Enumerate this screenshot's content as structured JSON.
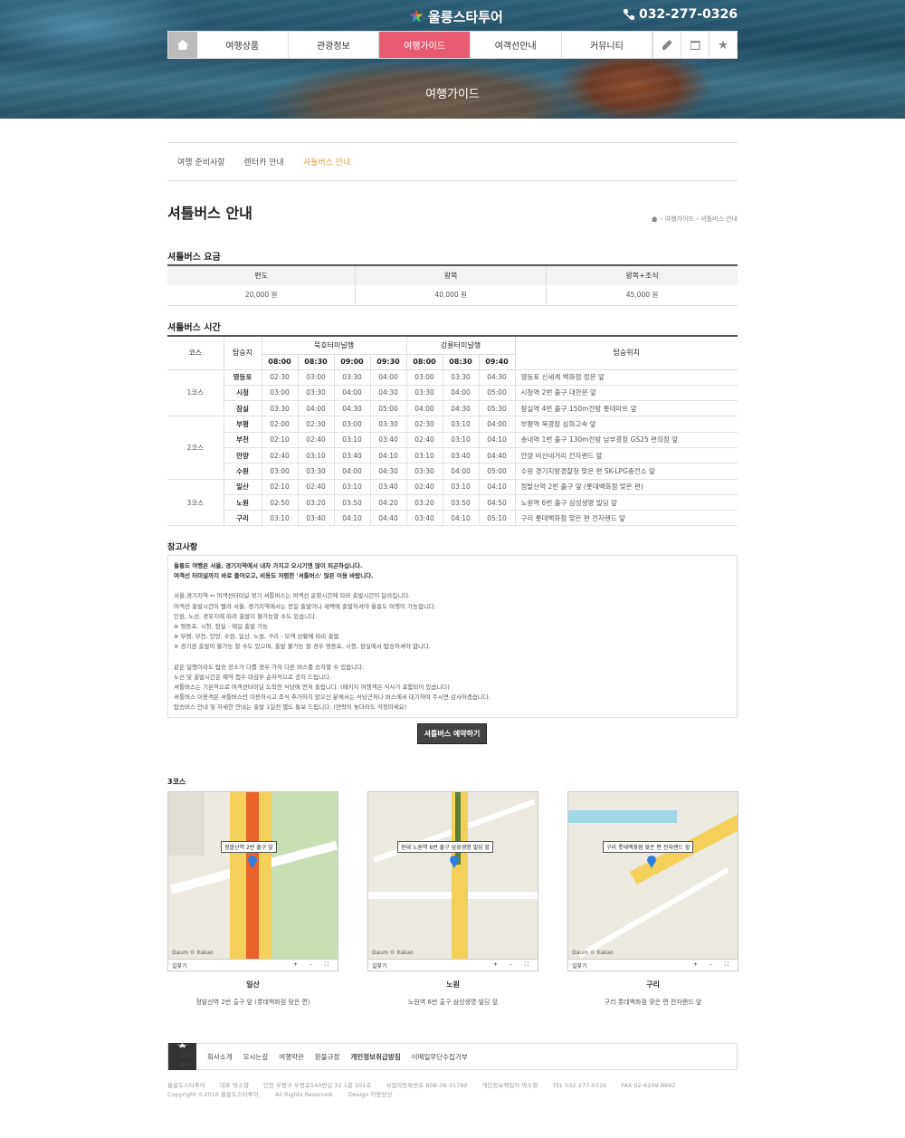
{
  "header": {
    "logo_text": "울릉스타투어",
    "phone": "032-277-0326",
    "nav": [
      "여행상품",
      "관광정보",
      "여행가이드",
      "여객선안내",
      "커뮤니티"
    ],
    "active_nav": "여행가이드",
    "hero_title": "여행가이드"
  },
  "subnav": [
    "여행 준비사항",
    "렌터카 안내",
    "셔틀버스 안내"
  ],
  "page_title": "셔틀버스 안내",
  "breadcrumb": "› 여행가이드 › 셔틀버스 안내",
  "fare": {
    "title": "셔틀버스 요금",
    "headers": [
      "편도",
      "왕복",
      "왕복+조식"
    ],
    "values": [
      "20,000 원",
      "40,000 원",
      "45,000 원"
    ]
  },
  "schedule": {
    "title": "셔틀버스 시간",
    "h_course": "코스",
    "h_stop": "탑승지",
    "h_mukho": "묵호터미널행",
    "h_gangneung": "강릉터미널행",
    "h_loc": "탑승위치",
    "times": [
      "08:00",
      "08:30",
      "09:00",
      "09:30",
      "08:00",
      "08:30",
      "09:40"
    ],
    "courses": [
      {
        "name": "1코스",
        "rows": [
          {
            "stop": "영등포",
            "t": [
              "02:30",
              "03:00",
              "03:30",
              "04:00",
              "03:00",
              "03:30",
              "04:30"
            ],
            "loc": "영등포 신세계 백화점 정문 앞"
          },
          {
            "stop": "시청",
            "t": [
              "03:00",
              "03:30",
              "04:00",
              "04:30",
              "03:30",
              "04:00",
              "05:00"
            ],
            "loc": "시청역 2번 출구 대한문 앞"
          },
          {
            "stop": "잠실",
            "t": [
              "03:30",
              "04:00",
              "04:30",
              "05:00",
              "04:00",
              "04:30",
              "05:30"
            ],
            "loc": "잠실역 4번 출구 150m전방 롯데마트 앞"
          }
        ]
      },
      {
        "name": "2코스",
        "rows": [
          {
            "stop": "부평",
            "t": [
              "02:00",
              "02:30",
              "03:00",
              "03:30",
              "02:30",
              "03:10",
              "04:00"
            ],
            "loc": "부평역 북광장 삼화고속 앞"
          },
          {
            "stop": "부천",
            "t": [
              "02:10",
              "02:40",
              "03:10",
              "03:40",
              "02:40",
              "03:10",
              "04:10"
            ],
            "loc": "송내역 1번 출구 130m전방 남부광장 GS25 편의점 앞"
          },
          {
            "stop": "안양",
            "t": [
              "02:40",
              "03:10",
              "03:40",
              "04:10",
              "03:10",
              "03:40",
              "04:40"
            ],
            "loc": "안양 비산네거리 전자랜드 앞"
          },
          {
            "stop": "수원",
            "t": [
              "03:00",
              "03:30",
              "04:00",
              "04:30",
              "03:30",
              "04:00",
              "05:00"
            ],
            "loc": "수원 경기지방경찰청 맞은 편 SK-LPG충전소 앞"
          }
        ]
      },
      {
        "name": "3코스",
        "rows": [
          {
            "stop": "일산",
            "t": [
              "02:10",
              "02:40",
              "03:10",
              "03:40",
              "02:40",
              "03:10",
              "04:10"
            ],
            "loc": "정발산역 2번 출구 앞 (롯데백화점 맞은 편)"
          },
          {
            "stop": "노원",
            "t": [
              "02:50",
              "03:20",
              "03:50",
              "04:20",
              "03:20",
              "03:50",
              "04:50"
            ],
            "loc": "노원역 6번 출구 삼성생명 빌딩 앞"
          },
          {
            "stop": "구리",
            "t": [
              "03:10",
              "03:40",
              "04:10",
              "04:40",
              "03:40",
              "04:10",
              "05:10"
            ],
            "loc": "구리 롯데백화점 맞은 편 전자랜드 앞"
          }
        ]
      }
    ]
  },
  "notes": {
    "title": "참고사항",
    "intro": [
      "울릉도 여행은 서울, 경기지역에서 내차 가지고 오시기엔 많이 피곤하십니다.",
      "여객선 터미널까지 바로 들어오고, 비용도 저렴한 '셔틀버스' 많은 이용 바랍니다."
    ],
    "block1": [
      "서울,경기지역 ↔ 여객선터미널 정기 셔틀버스는 여객선 운항시간에 따라 출발시간이 달라집니다.",
      "여객선 출발시간이 빨라 서울, 경기지역에서는 전일 출발이나 새벽에 출발하셔야 울릉도 여행이 가능합니다.",
      "인원, 노선, 경유지에 따라 출발이 불가능할 수도 있습니다.",
      "※ 영등포, 시청, 잠실 - 매일 출발 가능",
      "※ 부평, 부천, 안양, 수원, 일산, 노원, 구리 - 모객 상황에 따라 출발",
      "※ 경기권 출발이 불가능 할 수도 있으며, 출발 불가능 할 경우 영등포, 시청, 잠실에서 탑승하셔야 합니다."
    ],
    "block2": [
      "같은 일행이라도 탑승 장소가 다를 경우 가자 다른 버스를 승차할 수 있습니다.",
      "노선 및 출발시간은 예약 접수 마감후 순차적으로 공지 드립니다.",
      "셔틀버스는 기본적으로 여객선터미널 도착전 식당에 먼저 들립니다. (패키지 여행객은 식사가 포함되어 있습니다)",
      "셔틀버스 이용객은 셔틀버스만 이용하시고 조식 추가하지 않으신 분께서는 식당근처나 버스에서 대기하여 주시면 감사하겠습니다.",
      "탑승버스 안내 및 자세한 안내는 출발 1일전 별도 통보 드립니다. (연락이 늦더라도 걱정마세요)"
    ]
  },
  "reserve_button": "셔틀버스 예약하기",
  "maps": {
    "title": "3코스",
    "items": [
      {
        "callout": "정발산역 2번 출구 앞",
        "name": "일산",
        "desc": "정발산역 2번 출구 앞 (롯데백화점 맞은 편)"
      },
      {
        "callout": "현대 노원역 6번 출구 삼성생명 빌딩 앞",
        "name": "노원",
        "desc": "노원역 6번 출구 삼성생명 빌딩 앞"
      },
      {
        "callout": "구리 롯데백화점 맞은 편 전자랜드 앞",
        "name": "구리",
        "desc": "구리 롯데백화점 맞은 편 전자랜드 앞"
      }
    ],
    "route_label": "길찾기",
    "brand": "Daum © Kakao",
    "controls": "+ - ⛶"
  },
  "footer": {
    "logo": "스타투어",
    "links": [
      "회사소개",
      "오시는길",
      "여행약관",
      "환불규정",
      "개인정보취급방침",
      "이메일무단수집거부"
    ],
    "info": [
      "울릉도스타투어",
      "대표 박소향",
      "인천 부평구 부평로540번길 32 1층 101호",
      "사업자등록번호 608-38-35780",
      "개인정보책임자 박소향",
      "TEL 032-277-0326",
      "FAX 02-6209-8892"
    ],
    "copyright": [
      "Copyright ©2016 울릉도스타투어.",
      "All Rights Reserved.",
      "Design 이랑상상"
    ]
  },
  "colors": {
    "accent": "#e65b6f",
    "active_sub": "#e6a23c",
    "button": "#444444"
  }
}
